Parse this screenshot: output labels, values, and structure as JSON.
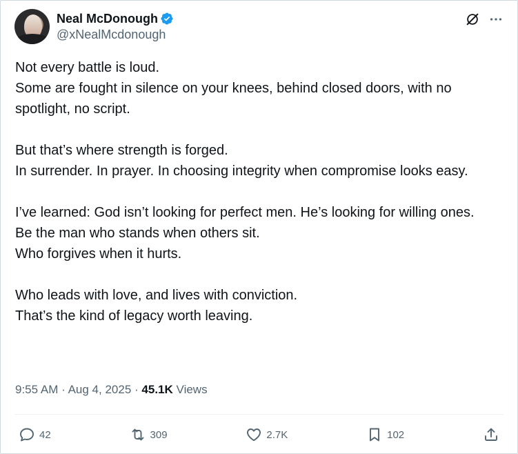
{
  "author": {
    "display_name": "Neal McDonough",
    "handle": "@xNealMcdonough",
    "verified_color": "#1d9bf0"
  },
  "tweet": {
    "paragraphs": [
      "Not every battle is loud.\nSome are fought in silence on your knees, behind closed doors, with no spotlight, no script.",
      "But that’s where strength is forged.\nIn surrender. In prayer. In choosing integrity when compromise looks easy.",
      "I’ve learned: God isn’t looking for perfect men. He’s looking for willing ones.\nBe the man who stands when others sit.\nWho forgives when it hurts.",
      "Who leads with love, and lives with conviction.\nThat’s the kind of legacy worth leaving."
    ],
    "time": "9:55 AM",
    "separator": "·",
    "date": "Aug 4, 2025",
    "views_count": "45.1K",
    "views_label": "Views"
  },
  "actions": {
    "replies": "42",
    "reposts": "309",
    "likes": "2.7K",
    "bookmarks": "102"
  },
  "icons": {
    "grok": "grok-icon",
    "more": "more-icon",
    "reply": "reply-icon",
    "repost": "repost-icon",
    "like": "heart-icon",
    "bookmark": "bookmark-icon",
    "share": "share-icon"
  }
}
